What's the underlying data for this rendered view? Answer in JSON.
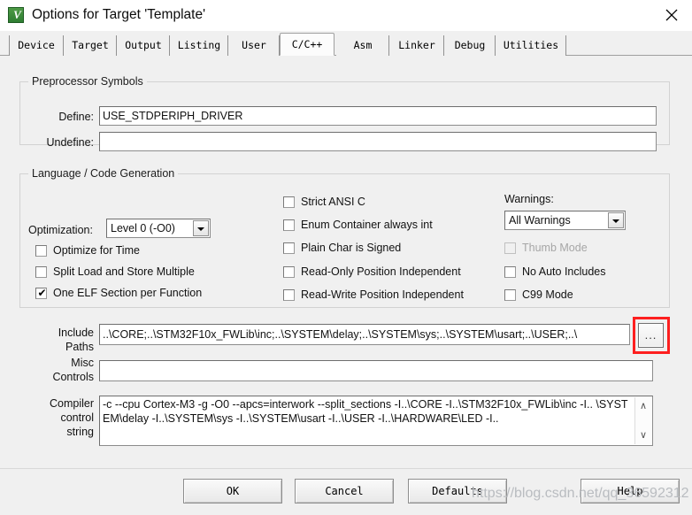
{
  "window": {
    "title": "Options for Target 'Template'",
    "icon": "uvision-logo-icon",
    "close_label": "✕"
  },
  "tabs": [
    {
      "label": "Device",
      "active": false
    },
    {
      "label": "Target",
      "active": false
    },
    {
      "label": "Output",
      "active": false
    },
    {
      "label": "Listing",
      "active": false
    },
    {
      "label": "User",
      "active": false
    },
    {
      "label": "C/C++",
      "active": true
    },
    {
      "label": "Asm",
      "active": false
    },
    {
      "label": "Linker",
      "active": false
    },
    {
      "label": "Debug",
      "active": false
    },
    {
      "label": "Utilities",
      "active": false
    }
  ],
  "preprocessor": {
    "group_title": "Preprocessor Symbols",
    "define_label": "Define:",
    "define_value": "USE_STDPERIPH_DRIVER",
    "undefine_label": "Undefine:",
    "undefine_value": ""
  },
  "language": {
    "group_title": "Language / Code Generation",
    "optimization_label": "Optimization:",
    "optimization_value": "Level 0 (-O0)",
    "warnings_label": "Warnings:",
    "warnings_value": "All Warnings",
    "left_checks": [
      {
        "label": "Optimize for Time",
        "checked": false,
        "disabled": false
      },
      {
        "label": "Split Load and Store Multiple",
        "checked": false,
        "disabled": false
      },
      {
        "label": "One ELF Section per Function",
        "checked": true,
        "disabled": false
      }
    ],
    "mid_checks": [
      {
        "label": "Strict ANSI C",
        "checked": false,
        "disabled": false
      },
      {
        "label": "Enum Container always int",
        "checked": false,
        "disabled": false
      },
      {
        "label": "Plain Char is Signed",
        "checked": false,
        "disabled": false
      },
      {
        "label": "Read-Only Position Independent",
        "checked": false,
        "disabled": false
      },
      {
        "label": "Read-Write Position Independent",
        "checked": false,
        "disabled": false
      }
    ],
    "right_checks": [
      {
        "label": "Thumb Mode",
        "checked": false,
        "disabled": true
      },
      {
        "label": "No Auto Includes",
        "checked": false,
        "disabled": false
      },
      {
        "label": "C99 Mode",
        "checked": false,
        "disabled": false
      }
    ],
    "checkmark": "✔"
  },
  "paths": {
    "include_label_line1": "Include",
    "include_label_line2": "Paths",
    "include_value": "..\\CORE;..\\STM32F10x_FWLib\\inc;..\\SYSTEM\\delay;..\\SYSTEM\\sys;..\\SYSTEM\\usart;..\\USER;..\\",
    "browse_label": "...",
    "misc_label_line1": "Misc",
    "misc_label_line2": "Controls",
    "misc_value": "",
    "compiler_label_line1": "Compiler",
    "compiler_label_line2": "control",
    "compiler_label_line3": "string",
    "compiler_value": "-c --cpu Cortex-M3 -g -O0 --apcs=interwork --split_sections -I..\\CORE -I..\\STM32F10x_FWLib\\inc -I.. \\SYSTEM\\delay -I..\\SYSTEM\\sys -I..\\SYSTEM\\usart -I..\\USER -I..\\HARDWARE\\LED -I..",
    "scroll_up": "∧",
    "scroll_down": "∨"
  },
  "footer": {
    "ok": "OK",
    "cancel": "Cancel",
    "defaults": "Defaults",
    "help": "Help"
  },
  "watermark": "https://blog.csdn.net/qq_36592312",
  "colors": {
    "accent_highlight": "#fd1f1f",
    "dialog_bg": "#f0f0f0",
    "field_bg": "#ffffff"
  }
}
